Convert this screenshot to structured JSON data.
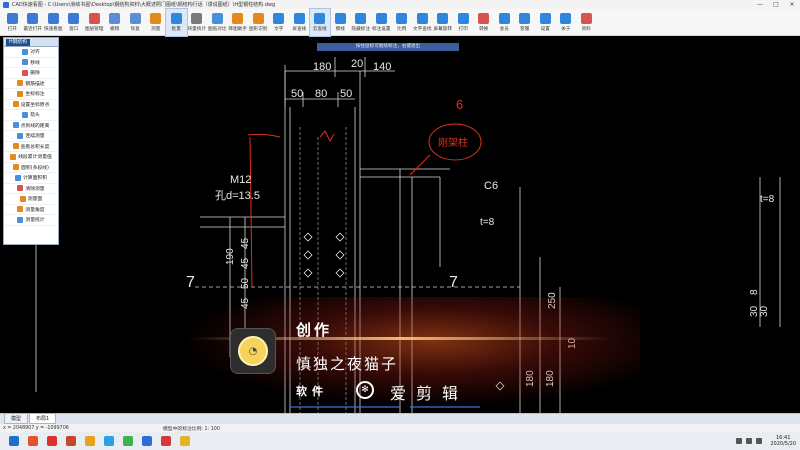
{
  "window": {
    "title": "CAD快速看图 - C:\\Users\\滑绩书屋\\Desktop\\钢结构资料\\大概述照门图纸\\钢结构行话（漫说图纸）\\H型钢柱结构.dwg",
    "controls": [
      "—",
      "□",
      "✕"
    ]
  },
  "ribbon": [
    {
      "label": "打开",
      "color": "#3b7bd8"
    },
    {
      "label": "最近打开",
      "color": "#3b7bd8"
    },
    {
      "label": "快速看图",
      "color": "#3b7bd8"
    },
    {
      "label": "窗口",
      "color": "#3b7bd8"
    },
    {
      "label": "图层管理",
      "color": "#d9534f"
    },
    {
      "label": "撤销",
      "color": "#5a8fd8"
    },
    {
      "label": "恢复",
      "color": "#5a8fd8"
    },
    {
      "label": "测量",
      "color": "#e28a1c"
    },
    {
      "label": "批量",
      "color": "#2e86de",
      "selected": true
    },
    {
      "label": "块量统计",
      "color": "#7a7a7a"
    },
    {
      "label": "图纸对比",
      "color": "#4a90d9"
    },
    {
      "label": "降图助手",
      "color": "#e28a1c"
    },
    {
      "label": "图形识别",
      "color": "#e28a1c"
    },
    {
      "label": "文字",
      "color": "#2e86de"
    },
    {
      "label": "屏查线",
      "color": "#2e86de"
    },
    {
      "label": "云查线",
      "color": "#2e86de",
      "selected": true
    },
    {
      "label": "擦线",
      "color": "#2e86de"
    },
    {
      "label": "隐藏标注",
      "color": "#2e86de"
    },
    {
      "label": "标注设置",
      "color": "#2e86de"
    },
    {
      "label": "比例",
      "color": "#2e86de"
    },
    {
      "label": "文字查找",
      "color": "#2e86de"
    },
    {
      "label": "屏幕旋转",
      "color": "#2e86de"
    },
    {
      "label": "打印",
      "color": "#2e86de"
    },
    {
      "label": "转换",
      "color": "#d9534f"
    },
    {
      "label": "会员",
      "color": "#2e86de"
    },
    {
      "label": "客服",
      "color": "#2e86de"
    },
    {
      "label": "设置",
      "color": "#2e86de"
    },
    {
      "label": "关于",
      "color": "#2e86de"
    },
    {
      "label": "资料",
      "color": "#d9534f"
    }
  ],
  "panel": {
    "tab": "H钢结构",
    "items": [
      {
        "label": "对齐",
        "color": "#4a90d9"
      },
      {
        "label": "移线",
        "color": "#4a90d9"
      },
      {
        "label": "删除",
        "color": "#d9534f"
      },
      {
        "label": "钢筋描述",
        "color": "#e28a1c"
      },
      {
        "label": "坐标标注",
        "color": "#e28a1c"
      },
      {
        "label": "设置坐标原点",
        "color": "#e28a1c"
      },
      {
        "label": "箭头",
        "color": "#4a90d9"
      },
      {
        "label": "点到线的距离",
        "color": "#4a90d9"
      },
      {
        "label": "连续测量",
        "color": "#4a90d9"
      },
      {
        "label": "查看总积长度",
        "color": "#e28a1c"
      },
      {
        "label": "线段累计测量值",
        "color": "#e28a1c"
      },
      {
        "label": "面积(多段线)",
        "color": "#e28a1c"
      },
      {
        "label": "计算面积积",
        "color": "#4a90d9"
      },
      {
        "label": "清除测量",
        "color": "#d9534f"
      },
      {
        "label": "测量面",
        "color": "#e28a1c"
      },
      {
        "label": "测量角度",
        "color": "#e28a1c"
      },
      {
        "label": "测量统计",
        "color": "#4a90d9"
      }
    ]
  },
  "canvas": {
    "notice": "按住鼠标可继续标注，右键退出",
    "dims_top": [
      "180",
      "20",
      "140"
    ],
    "dims_sub": [
      "50",
      "80",
      "50"
    ],
    "labels": {
      "bolt": "M12",
      "hole": "孔d=13.5",
      "steel": "C6",
      "plate": "t=8",
      "plate_right": "t=8",
      "section_left": "7",
      "section_right": "7",
      "handwriting": "刚架柱",
      "mark6": "6"
    },
    "dims_vertical": [
      "190",
      "250",
      "10",
      "180",
      "180"
    ],
    "dims_right": [
      "8",
      "30",
      "30"
    ],
    "dims_left_column": [
      "45",
      "45",
      "50",
      "45"
    ]
  },
  "watermark": {
    "title": "创作",
    "name": "慎独之夜猫子",
    "software": "软件",
    "app": "爱剪辑"
  },
  "tabs": [
    {
      "label": "模型",
      "active": false
    },
    {
      "label": "布局1",
      "active": true
    }
  ],
  "status": {
    "coords": "x = 2048907  y = -1099706",
    "scale": "模型中的标注比例: 1: 100"
  },
  "taskbar": {
    "apps": [
      {
        "name": "start-icon",
        "color": "#1f6fd1"
      },
      {
        "name": "browser-icon",
        "color": "#e5532d"
      },
      {
        "name": "wps-icon",
        "color": "#d9312b"
      },
      {
        "name": "ppt-icon",
        "color": "#c8462b"
      },
      {
        "name": "video-icon",
        "color": "#e8a21a"
      },
      {
        "name": "qq-icon",
        "color": "#2aa0e6"
      },
      {
        "name": "wechat-icon",
        "color": "#3db34a"
      },
      {
        "name": "cad-icon",
        "color": "#2b6fd6"
      },
      {
        "name": "music-icon",
        "color": "#d13a3a"
      },
      {
        "name": "folder-icon",
        "color": "#e6b422"
      }
    ],
    "time": "16:41",
    "date": "2020/5/20"
  }
}
